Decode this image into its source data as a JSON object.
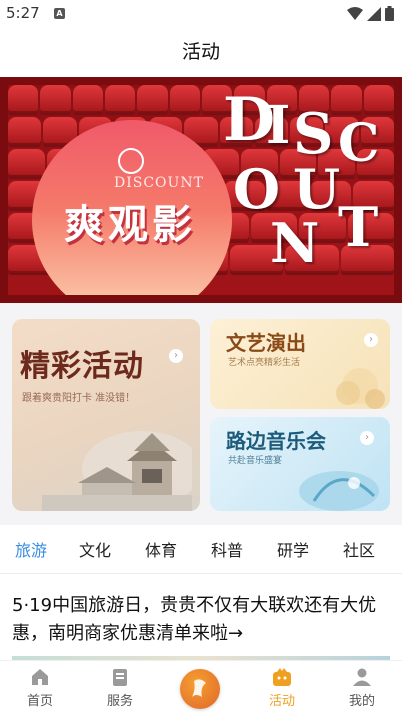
{
  "status_bar": {
    "time": "5:27",
    "notification_letter": "A"
  },
  "header": {
    "title": "活动"
  },
  "banner": {
    "brand": "爽观影",
    "tagline": "DISCOUNT",
    "big_letters": [
      "D",
      "I",
      "S",
      "C",
      "O",
      "U",
      "N",
      "T"
    ]
  },
  "cards": {
    "left": {
      "title": "精彩活动",
      "subtitle": "跟着爽贵阳打卡  准没错！"
    },
    "right_top": {
      "title": "文艺演出",
      "subtitle": "艺术点亮精彩生活"
    },
    "right_bottom": {
      "title": "路边音乐会",
      "subtitle": "共赴音乐盛宴"
    }
  },
  "categories": [
    "旅游",
    "文化",
    "体育",
    "科普",
    "研学",
    "社区"
  ],
  "active_category": "旅游",
  "article": {
    "title": "5·19中国旅游日，贵贵不仅有大联欢还有大优惠，南明商家优惠清单来啦→"
  },
  "bottom_nav": {
    "items": [
      {
        "label": "首页",
        "icon": "home-icon"
      },
      {
        "label": "服务",
        "icon": "service-icon"
      },
      {
        "label": "",
        "icon": "center-logo-icon"
      },
      {
        "label": "活动",
        "icon": "activity-icon"
      },
      {
        "label": "我的",
        "icon": "profile-icon"
      }
    ],
    "active": "活动"
  },
  "colors": {
    "accent_blue": "#3a8de0",
    "active_orange": "#f0a020",
    "banner_red": "#a01418"
  }
}
